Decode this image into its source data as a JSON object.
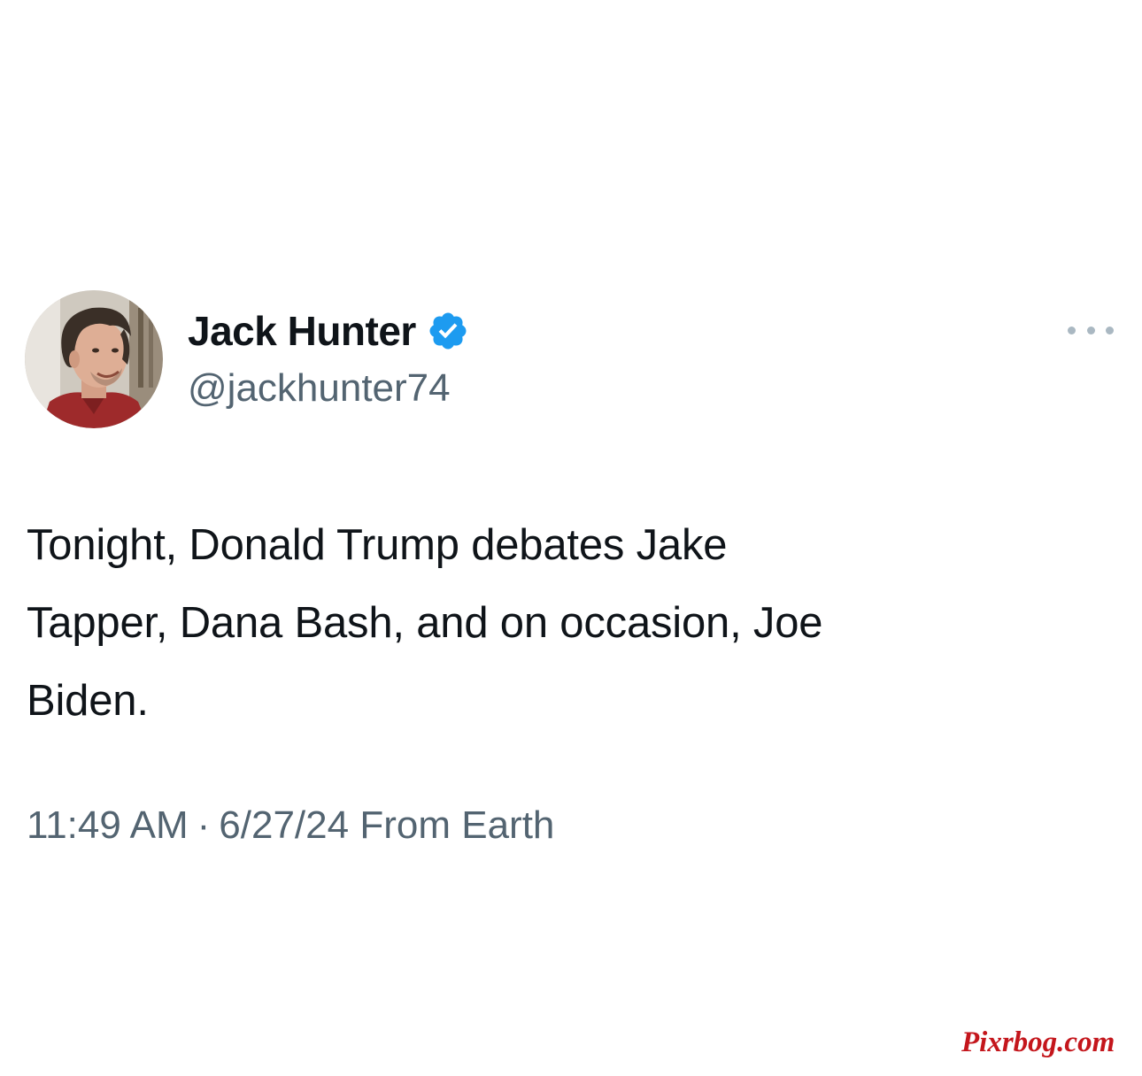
{
  "author": {
    "display_name": "Jack Hunter",
    "handle": "@jackhunter74",
    "verified": true,
    "avatar_icon": "profile-photo"
  },
  "tweet": {
    "text_lines": [
      "Tonight, Donald Trump debates Jake",
      "Tapper, Dana Bash, and on occasion, Joe",
      "Biden."
    ],
    "time": "11:49 AM",
    "separator": "·",
    "date": "6/27/24",
    "source": "From Earth"
  },
  "menu": {
    "more_icon": "more-horizontal-icon"
  },
  "watermark": {
    "text": "Pixrbog.com"
  },
  "colors": {
    "text_primary": "#0f1419",
    "text_secondary": "#536471",
    "verified_blue": "#1d9bf0",
    "watermark_red": "#c4161c"
  }
}
